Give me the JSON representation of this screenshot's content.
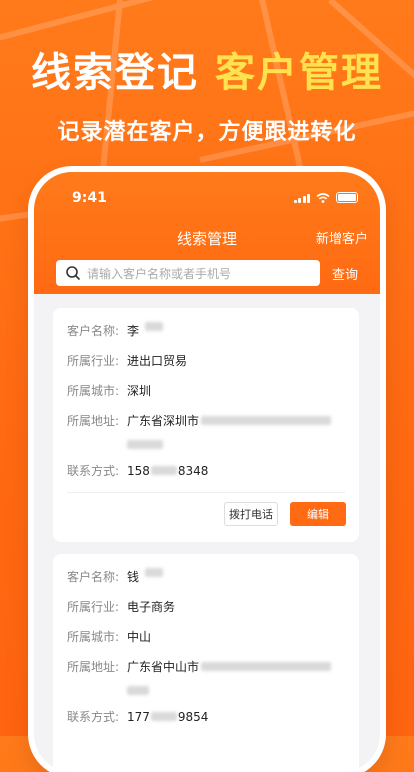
{
  "promo": {
    "title_white": "线索登记",
    "title_yellow": "客户管理",
    "subtitle": "记录潜在客户，方便跟进转化"
  },
  "status_bar": {
    "time": "9:41"
  },
  "nav": {
    "title": "线索管理",
    "action": "新增客户"
  },
  "search": {
    "placeholder": "请输入客户名称或者手机号",
    "button": "查询"
  },
  "colors": {
    "accent": "#ff6a12",
    "highlight": "#ffe24d"
  },
  "cards": [
    {
      "name_label": "客户名称:",
      "name": "李",
      "industry_label": "所属行业:",
      "industry": "进出口贸易",
      "city_label": "所属城市:",
      "city": "深圳",
      "address_label": "所属地址:",
      "address": "广东省深圳市",
      "phone_label": "联系方式:",
      "phone_prefix": "158",
      "phone_suffix": "8348",
      "call_label": "拨打电话",
      "edit_label": "编辑"
    },
    {
      "name_label": "客户名称:",
      "name": "钱",
      "industry_label": "所属行业:",
      "industry": "电子商务",
      "city_label": "所属城市:",
      "city": "中山",
      "address_label": "所属地址:",
      "address": "广东省中山市",
      "phone_label": "联系方式:",
      "phone_prefix": "177",
      "phone_suffix": "9854"
    }
  ]
}
